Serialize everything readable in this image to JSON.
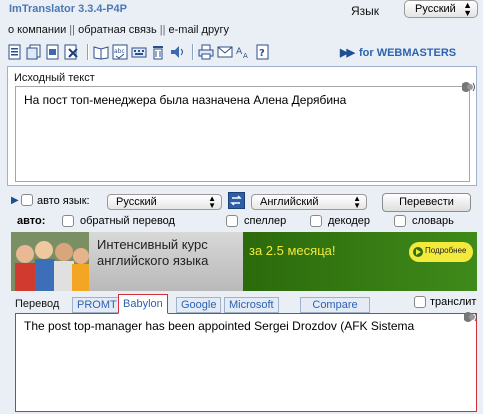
{
  "app": {
    "title": "ImTranslator 3.3.4-P4P"
  },
  "language": {
    "label": "Язык",
    "selected": "Русский"
  },
  "links": [
    "о компании",
    "обратная связь",
    "e-mail другу"
  ],
  "toolbar": {
    "icons": [
      "new-document-icon",
      "copy-icon",
      "clear-icon",
      "delete-icon",
      "dictionary-icon",
      "spellcheck-icon",
      "keyboard-icon",
      "trash-icon",
      "speech-icon",
      "print-icon",
      "email-icon",
      "font-size-icon",
      "help-icon"
    ],
    "webmasters_label": "for WEBMASTERS"
  },
  "source": {
    "label": "Исходный текст",
    "text": "На пост топ-менеджера была назначена Алена Дерябина"
  },
  "controls": {
    "auto_lang_label": "авто язык:",
    "from_lang": "Русский",
    "to_lang": "Английский",
    "translate_button": "Перевести",
    "auto_label": "авто:",
    "options": [
      "обратный перевод",
      "спеллер",
      "декодер",
      "словарь"
    ]
  },
  "banner": {
    "line1": "Интенсивный курс",
    "line2": "английского языка",
    "promo": "за 2.5 месяца!",
    "button": "Подробнее"
  },
  "translation": {
    "label": "Перевод",
    "tabs": [
      "PROMT",
      "Babylon",
      "Google",
      "Microsoft",
      "Compare"
    ],
    "active_tab": "Babylon",
    "translit_label": "транслит",
    "text": "The post top-manager has been appointed Sergei Drozdov (AFK Sistema"
  },
  "colors": {
    "background": "#eaeff6",
    "accent_blue": "#2d62b1",
    "active_border": "#d0303a",
    "banner_green": "#2f6f10",
    "banner_yellow": "#f3ea3b"
  }
}
